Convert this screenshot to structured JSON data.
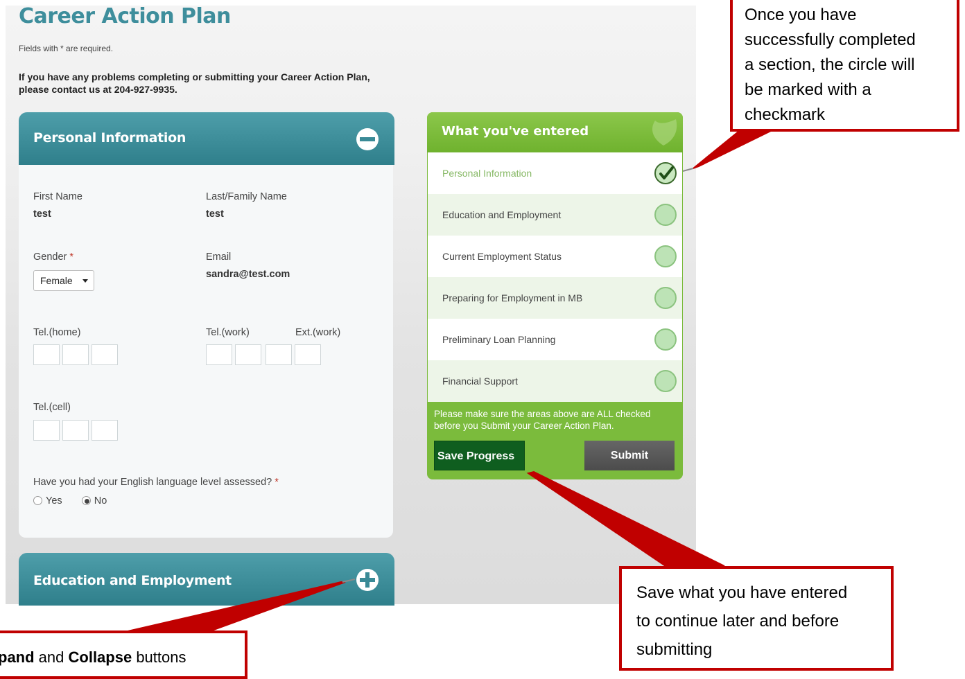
{
  "page": {
    "title": "Career Action Plan",
    "required_note": "Fields with * are required.",
    "contact_note_line1": "If you have any problems completing or submitting your Career Action Plan,",
    "contact_note_line2": "please contact us at 204-927-9935."
  },
  "sections": [
    {
      "title": "Personal Information",
      "state": "expanded",
      "toggle_icon": "minus-circle-icon"
    },
    {
      "title": "Education and Employment",
      "state": "collapsed",
      "toggle_icon": "plus-circle-icon"
    }
  ],
  "form": {
    "first_name_label": "First Name",
    "first_name_value": "test",
    "last_name_label": "Last/Family Name",
    "last_name_value": "test",
    "gender_label": "Gender",
    "required_mark": "*",
    "gender_value": "Female",
    "email_label": "Email",
    "email_value": "sandra@test.com",
    "tel_home_label": "Tel.(home)",
    "tel_work_label": "Tel.(work)",
    "ext_work_label": "Ext.(work)",
    "tel_cell_label": "Tel.(cell)",
    "english_question": "Have you had your English language level assessed?",
    "english_yes": "Yes",
    "english_no": "No",
    "english_selected": "No"
  },
  "panel": {
    "title": "What you've entered",
    "items": [
      {
        "label": "Personal Information",
        "completed": true
      },
      {
        "label": "Education and Employment",
        "completed": false
      },
      {
        "label": "Current Employment Status",
        "completed": false
      },
      {
        "label": "Preparing for Employment in MB",
        "completed": false
      },
      {
        "label": "Preliminary Loan Planning",
        "completed": false
      },
      {
        "label": "Financial Support",
        "completed": false
      }
    ],
    "note_line1": "Please make sure the areas above are ALL checked",
    "note_line2": "before you Submit your Career Action Plan.",
    "save_label": "Save Progress",
    "submit_label": "Submit",
    "colors": {
      "accent_teal": "#3e8e9c",
      "panel_green": "#7bbb3c",
      "save_green": "#0f5e1f"
    }
  },
  "annotations": {
    "checkmark_note": [
      "Once you have",
      "successfully completed",
      "a section, the circle will",
      "be marked with a",
      "checkmark"
    ],
    "save_note": [
      "Save what you have entered",
      "to continue later and before",
      "submitting"
    ],
    "expand_note_bold1": "pand",
    "expand_note_mid": " and ",
    "expand_note_bold2": "Collapse",
    "expand_note_end": " buttons",
    "color": "#c00000"
  }
}
